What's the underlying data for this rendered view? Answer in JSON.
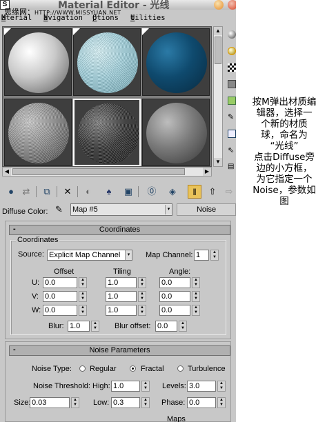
{
  "watermark": {
    "logo": "S",
    "text": "思缘网：",
    "url": "HTTP://WWW.MISSYUAN.NET"
  },
  "window": {
    "title": "Material Editor - 光线"
  },
  "menu": [
    "Material",
    "Navigation",
    "Options",
    "Utilities"
  ],
  "slots": [
    {
      "name": "white-sphere",
      "colors": [
        "#ffffff",
        "#c9c9c9",
        "#5c5c5c"
      ]
    },
    {
      "name": "noise-blue-sphere",
      "colors": [
        "#d6f2f7",
        "#9fd0dc",
        "#6aa0ad"
      ]
    },
    {
      "name": "dark-blue-sphere",
      "colors": [
        "#2b7aa6",
        "#0f4a6e",
        "#082a40"
      ]
    },
    {
      "name": "grainy-gray-sphere",
      "colors": [
        "#c9c9c9",
        "#8a8a8a",
        "#3a3a3a"
      ]
    },
    {
      "name": "dark-texture-sphere",
      "colors": [
        "#7a7a7a",
        "#2e2e2e",
        "#0f0f0f"
      ]
    },
    {
      "name": "gray-sphere",
      "colors": [
        "#bdbdbd",
        "#7b7b7b",
        "#363636"
      ]
    }
  ],
  "diffuse": {
    "label": "Diffuse Color:",
    "map_name": "Map #5",
    "map_type": "Noise"
  },
  "coordinates": {
    "header": "Coordinates",
    "group_title": "Coordinates",
    "source_label": "Source:",
    "source_value": "Explicit Map Channel",
    "map_channel_label": "Map Channel:",
    "map_channel_value": "1",
    "col_offset": "Offset",
    "col_tiling": "Tiling",
    "col_angle": "Angle:",
    "rows": [
      {
        "label": "U:",
        "offset": "0.0",
        "tiling": "1.0",
        "angle": "0.0"
      },
      {
        "label": "V:",
        "offset": "0.0",
        "tiling": "1.0",
        "angle": "0.0"
      },
      {
        "label": "W:",
        "offset": "0.0",
        "tiling": "1.0",
        "angle": "0.0"
      }
    ],
    "blur_label": "Blur:",
    "blur_value": "1.0",
    "blur_offset_label": "Blur offset:",
    "blur_offset_value": "0.0"
  },
  "noise": {
    "header": "Noise Parameters",
    "type_label": "Noise Type:",
    "types": [
      "Regular",
      "Fractal",
      "Turbulence"
    ],
    "selected_type": "Fractal",
    "threshold_label": "Noise Threshold:",
    "high_label": "High:",
    "high_value": "1.0",
    "levels_label": "Levels:",
    "levels_value": "3.0",
    "size_label": "Size:",
    "size_value": "0.03",
    "low_label": "Low:",
    "low_value": "0.3",
    "phase_label": "Phase:",
    "phase_value": "0.0",
    "maps_label": "Maps"
  },
  "note_lines": [
    "按M弹出材质编",
    "辑器，选择一",
    "个新的材质",
    "球，命名为",
    "“光线”",
    "点击Diffuse旁",
    "边的小方框，",
    "为它指定一个",
    "Noise，参数如",
    "图"
  ]
}
